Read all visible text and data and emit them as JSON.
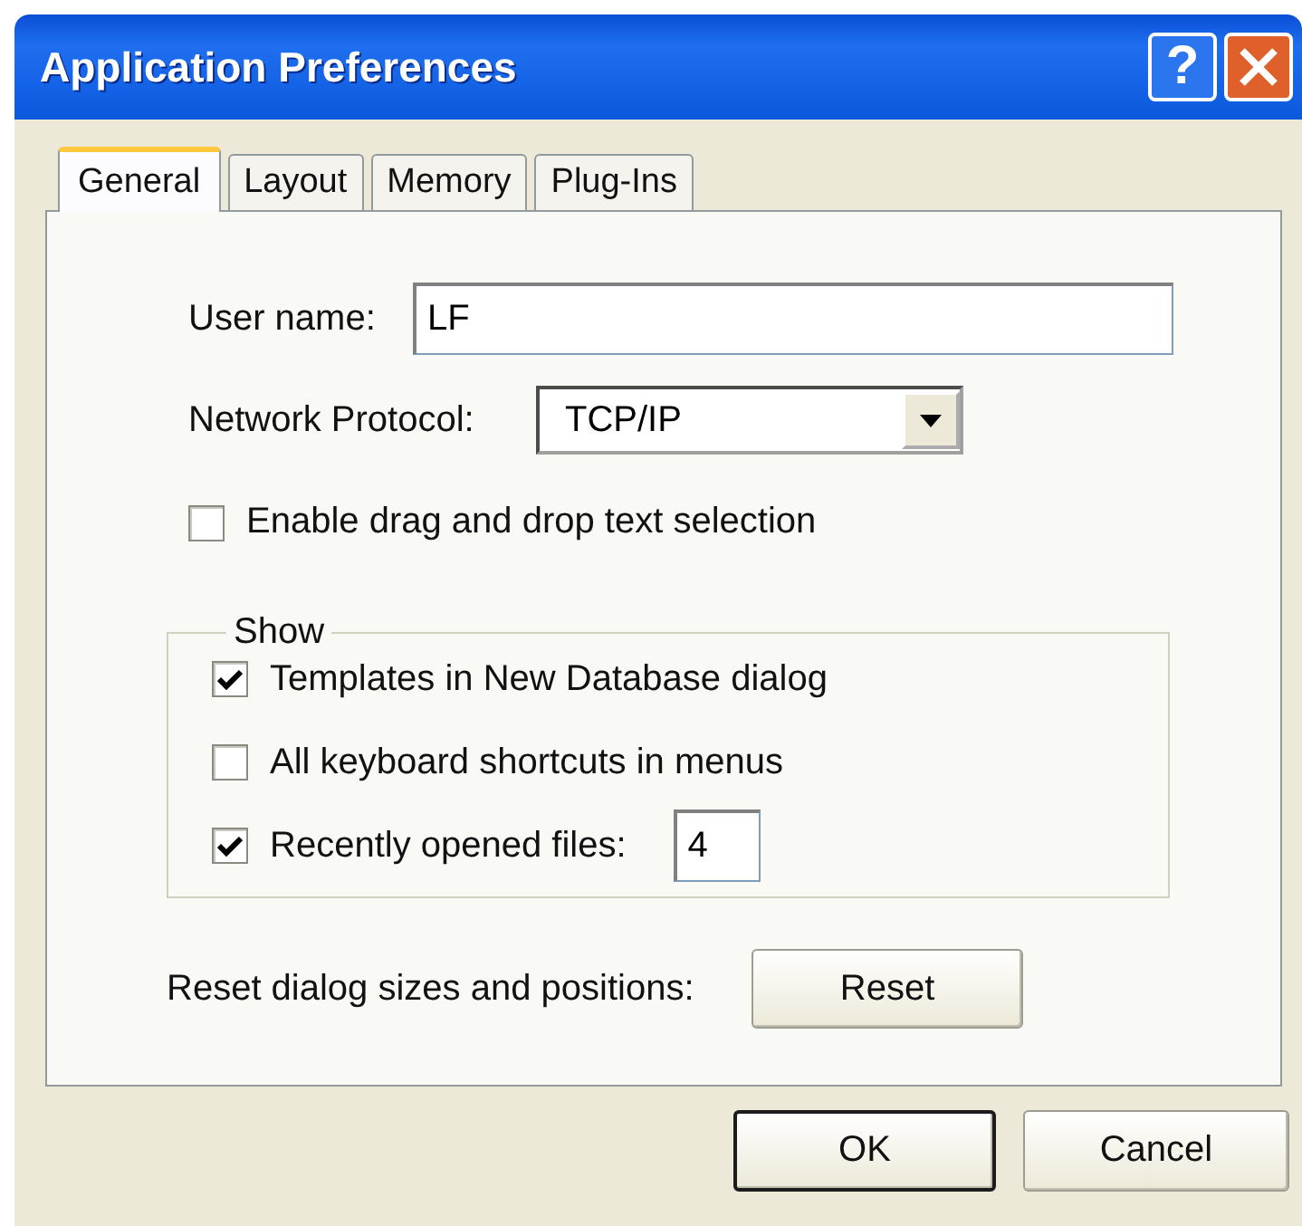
{
  "window": {
    "title": "Application Preferences",
    "help_label": "?"
  },
  "tabs": [
    {
      "label": "General",
      "selected": true
    },
    {
      "label": "Layout",
      "selected": false
    },
    {
      "label": "Memory",
      "selected": false
    },
    {
      "label": "Plug-Ins",
      "selected": false
    }
  ],
  "user_name": {
    "label": "User name:",
    "value": "LF"
  },
  "network_protocol": {
    "label": "Network Protocol:",
    "value": "TCP/IP"
  },
  "drag_drop": {
    "label": "Enable drag and drop text selection",
    "checked": false
  },
  "show_group": {
    "title": "Show",
    "options": [
      {
        "kind": "check",
        "label": "Templates in New Database dialog",
        "checked": true
      },
      {
        "kind": "check",
        "label": "All keyboard shortcuts in menus",
        "checked": false
      },
      {
        "kind": "number",
        "label": "Recently opened files:",
        "checked": true,
        "value": "4"
      }
    ]
  },
  "reset": {
    "label": "Reset dialog sizes and positions:",
    "button": "Reset"
  },
  "buttons": [
    {
      "label": "OK",
      "default": true
    },
    {
      "label": "Cancel",
      "default": false
    }
  ]
}
